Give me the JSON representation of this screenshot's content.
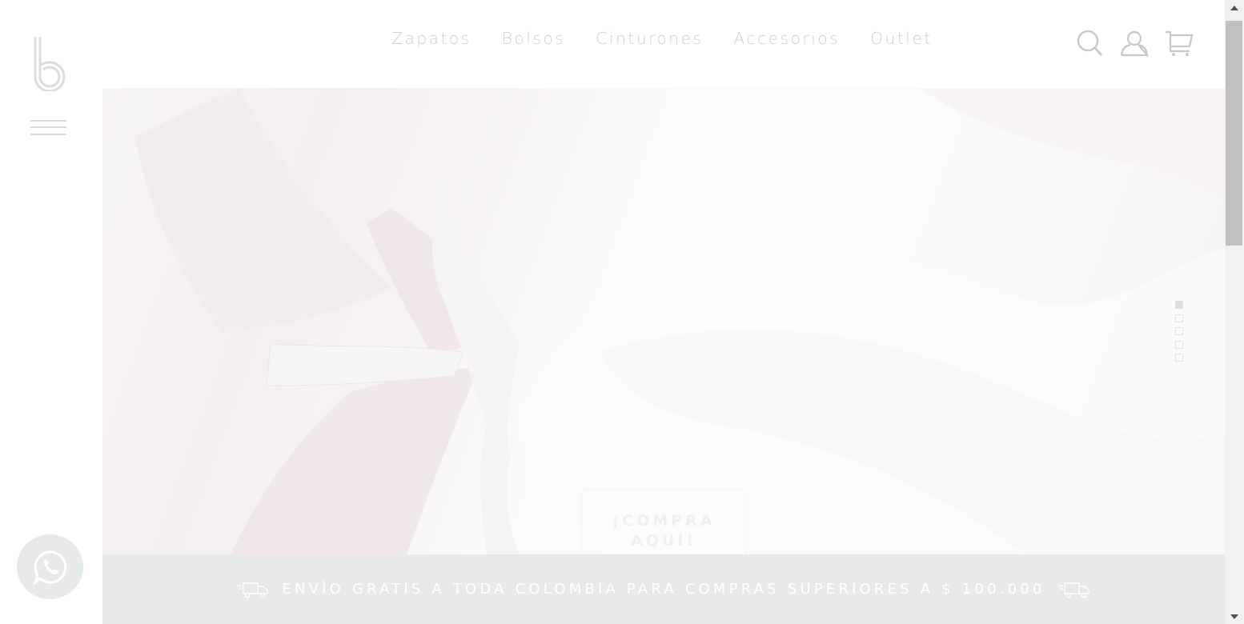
{
  "header": {
    "logo_icon": "b-logo-icon",
    "menu_icon": "hamburger-icon",
    "nav": [
      {
        "label": "Zapatos"
      },
      {
        "label": "Bolsos"
      },
      {
        "label": "Cinturones"
      },
      {
        "label": "Accesorios"
      },
      {
        "label": "Outlet"
      }
    ],
    "icons": [
      "search-icon",
      "user-icon",
      "cart-icon"
    ]
  },
  "hero": {
    "cta_line1": "¡COMPRA",
    "cta_line2": "AQUÍ!",
    "slides_count": 5,
    "active_slide": 1
  },
  "banner": {
    "text": "ENVÍO GRATIS A TODA COLOMBIA PARA COMPRAS SUPERIORES A $ 100.000",
    "icon": "delivery-truck-icon"
  },
  "floating": {
    "whatsapp_icon": "whatsapp-icon"
  },
  "colors": {
    "nav_text": "#cfcfcf",
    "banner_bg": "#e9e9e9",
    "banner_text": "#ffffff",
    "whatsapp_bg": "#e4ebea"
  }
}
